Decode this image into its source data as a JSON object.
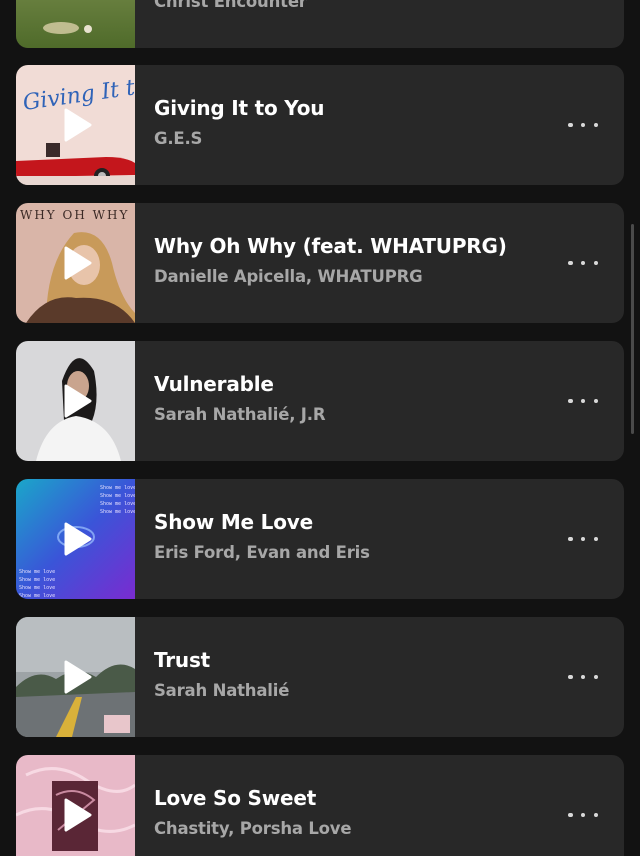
{
  "tracks": [
    {
      "title": "",
      "artist": "Christ Encounter",
      "art": "grass-icon"
    },
    {
      "title": "Giving It to You",
      "artist": "G.E.S",
      "art": "red-car-cover-icon"
    },
    {
      "title": "Why Oh Why (feat. WHATUPRG)",
      "artist": "Danielle Apicella, WHATUPRG",
      "art": "portrait-cover-icon"
    },
    {
      "title": "Vulnerable",
      "artist": "Sarah Nathalié, J.R",
      "art": "white-portrait-cover-icon"
    },
    {
      "title": "Show Me Love",
      "artist": "Eris Ford, Evan and Eris",
      "art": "purple-gradient-cover-icon"
    },
    {
      "title": "Trust",
      "artist": "Sarah Nathalié",
      "art": "road-landscape-cover-icon"
    },
    {
      "title": "Love So Sweet",
      "artist": "Chastity, Porsha Love",
      "art": "pink-script-cover-icon"
    }
  ],
  "cover_text": {
    "giving": "Giving It to You",
    "whyoh": "WHY OH WHY",
    "showme": "Show me love"
  },
  "colors": {
    "background": "#121212",
    "card": "#282828",
    "title": "#ffffff",
    "subtitle": "#a7a7a7"
  }
}
